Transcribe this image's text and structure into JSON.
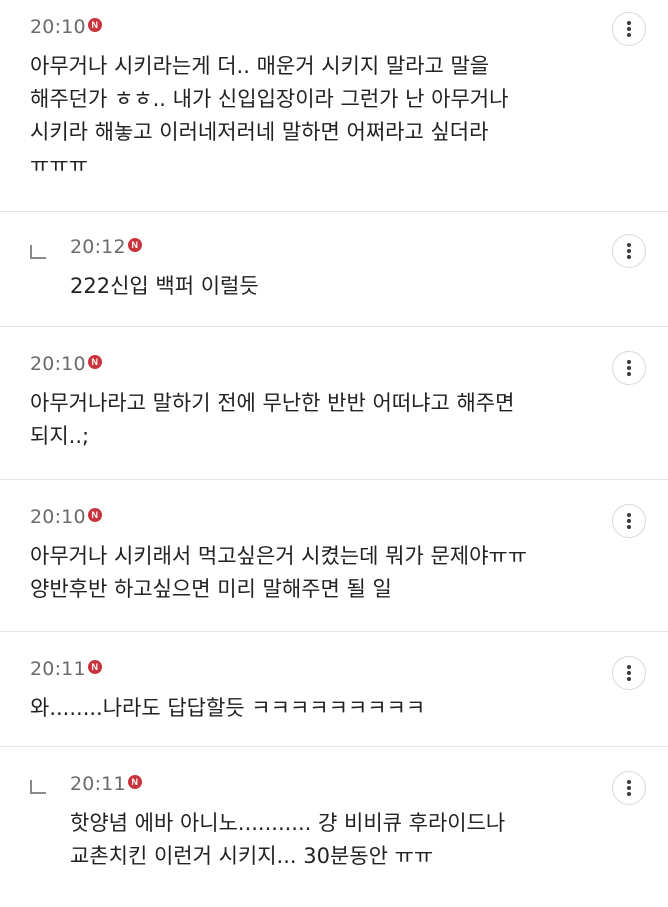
{
  "new_badge_label": "N",
  "comments": [
    {
      "time": "20:10",
      "reply": false,
      "lines": [
        "아무거나 시키라는게 더.. 매운거 시키지 말라고 말을",
        "해주던가 ㅎㅎ.. 내가 신입입장이라 그런가 난 아무거나",
        "시키라 해놓고 이러네저러네 말하면 어쩌라고 싶더라",
        "ㅠㅠㅠ"
      ]
    },
    {
      "time": "20:12",
      "reply": true,
      "lines": [
        "222신입 백퍼 이럴듯"
      ]
    },
    {
      "time": "20:10",
      "reply": false,
      "lines": [
        "아무거나라고 말하기 전에 무난한 반반 어떠냐고 해주면",
        "되지..;"
      ]
    },
    {
      "time": "20:10",
      "reply": false,
      "lines": [
        "아무거나 시키래서 먹고싶은거 시켰는데 뭐가 문제야ㅠㅠ",
        "양반후반 하고싶으면 미리 말해주면 될 일"
      ]
    },
    {
      "time": "20:11",
      "reply": false,
      "lines": [
        "와........나라도 답답할듯 ㅋㅋㅋㅋㅋㅋㅋㅋㅋ"
      ]
    },
    {
      "time": "20:11",
      "reply": true,
      "lines": [
        "핫양념 에바 아니노........... 걍 비비큐 후라이드나",
        "교촌치킨 이런거 시키지... 30분동안 ㅠㅠ"
      ]
    }
  ]
}
